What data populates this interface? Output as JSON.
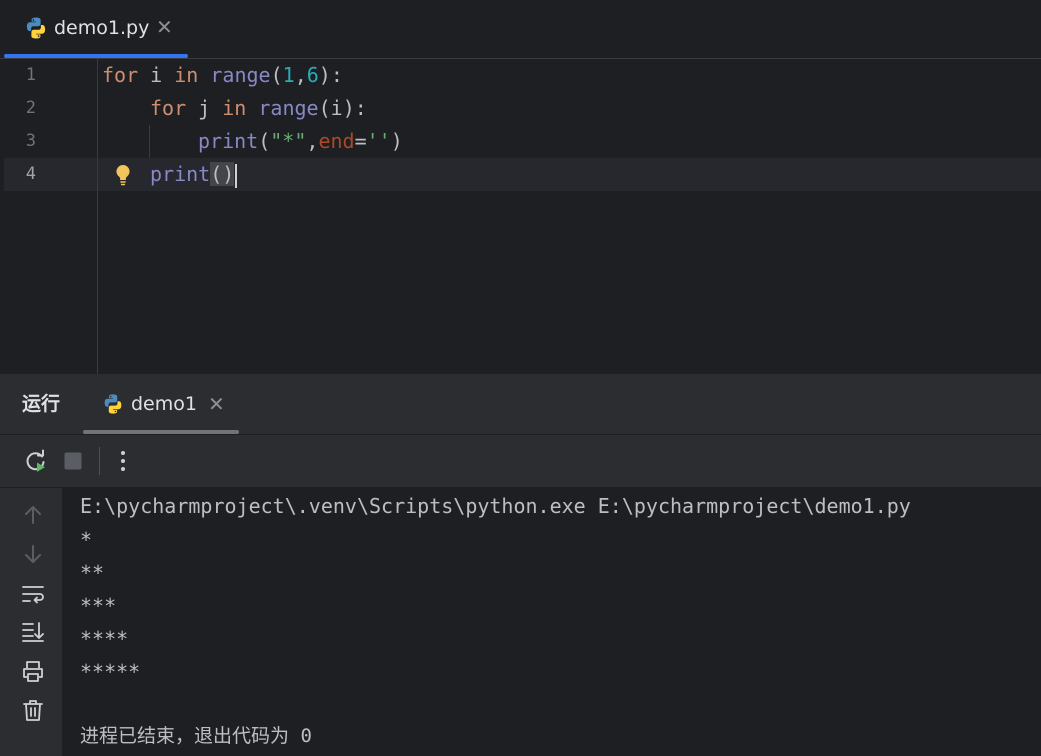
{
  "editor": {
    "tab": {
      "label": "demo1.py"
    },
    "line_numbers": [
      "1",
      "2",
      "3",
      "4"
    ],
    "code": {
      "line1": {
        "kw_for": "for",
        "var_i": " i ",
        "kw_in": "in",
        "sp": " ",
        "fn_range": "range",
        "lp": "(",
        "n1": "1",
        "comma": ",",
        "n6": "6",
        "rp": "):"
      },
      "line2": {
        "kw_for": "for",
        "var_j": " j ",
        "kw_in": "in",
        "sp": " ",
        "fn_range": "range",
        "arg": "(i):"
      },
      "line3": {
        "fn_print": "print",
        "lp": "(",
        "str_star": "\"*\"",
        "comma": ",",
        "param_end": "end",
        "eq": "=",
        "str_empty": "''",
        "rp": ")"
      },
      "line4": {
        "fn_print": "print",
        "parens": "()"
      }
    }
  },
  "run": {
    "title": "运行",
    "tab": {
      "label": "demo1"
    },
    "console": {
      "command": "E:\\pycharmproject\\.venv\\Scripts\\python.exe E:\\pycharmproject\\demo1.py",
      "output": [
        "*",
        "**",
        "***",
        "****",
        "*****"
      ],
      "exit_message": "进程已结束，退出代码为 0"
    }
  },
  "icons": {
    "file_type": "python-icon",
    "rerun": "rerun-icon",
    "stop": "stop-icon",
    "more": "more-vertical-icon",
    "scroll_up": "arrow-up-icon",
    "scroll_down": "arrow-down-icon",
    "soft_wrap": "soft-wrap-icon",
    "scroll_to_end": "scroll-to-end-icon",
    "print": "print-icon",
    "clear": "trash-icon",
    "intention": "lightbulb-icon"
  },
  "colors": {
    "accent": "#3574f0",
    "keyword": "#cf8e6d",
    "builtin": "#8888c6",
    "number": "#2aacb8",
    "string": "#6aab73",
    "parameter": "#aa4926"
  }
}
